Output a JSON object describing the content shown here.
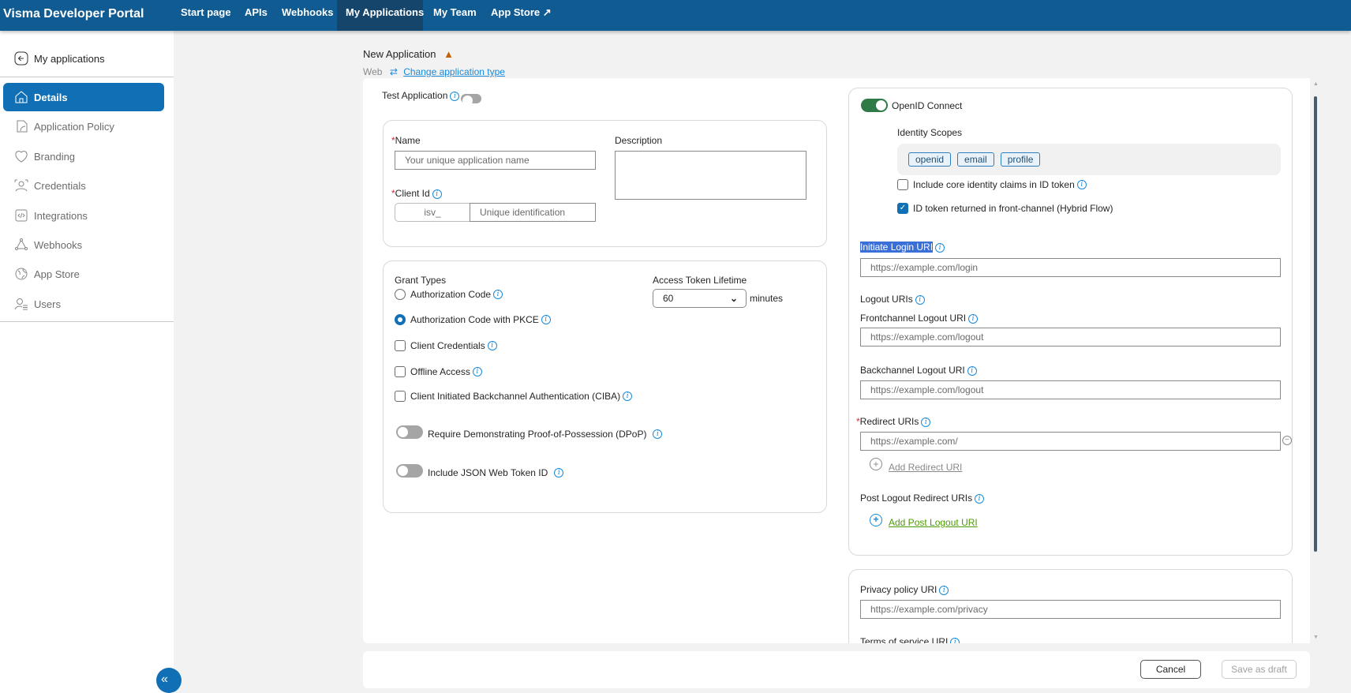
{
  "topnav": {
    "brand": "Visma Developer Portal",
    "items": [
      {
        "label": "Start page"
      },
      {
        "label": "APIs"
      },
      {
        "label": "Webhooks"
      },
      {
        "label": "My Applications",
        "active": true
      },
      {
        "label": "My Team"
      },
      {
        "label": "App Store"
      }
    ]
  },
  "sidebar": {
    "back": "My applications",
    "items": [
      {
        "label": "Details",
        "icon": "home-icon"
      },
      {
        "label": "Application Policy",
        "icon": "policy-icon"
      },
      {
        "label": "Branding",
        "icon": "heart-icon"
      },
      {
        "label": "Credentials",
        "icon": "credentials-icon"
      },
      {
        "label": "Integrations",
        "icon": "code-icon"
      },
      {
        "label": "Webhooks",
        "icon": "webhook-icon"
      },
      {
        "label": "App Store",
        "icon": "globe-icon"
      },
      {
        "label": "Users",
        "icon": "users-icon"
      }
    ]
  },
  "header": {
    "title": "New Application",
    "type": "Web",
    "change_type": "Change application type"
  },
  "form": {
    "test_application": "Test Application",
    "name_label": "Name",
    "name_placeholder": "Your unique application name",
    "description_label": "Description",
    "client_id_label": "Client Id",
    "client_id_prefix": "isv_",
    "client_id_placeholder": "Unique identification",
    "grant_types_label": "Grant Types",
    "grant_types": [
      {
        "label": "Authorization Code",
        "type": "radio",
        "checked": false
      },
      {
        "label": "Authorization Code with PKCE",
        "type": "radio",
        "checked": true
      },
      {
        "label": "Client Credentials",
        "type": "checkbox",
        "checked": false
      },
      {
        "label": "Offline Access",
        "type": "checkbox",
        "checked": false
      },
      {
        "label": "Client Initiated Backchannel Authentication (CIBA)",
        "type": "checkbox",
        "checked": false
      }
    ],
    "dpop": "Require Demonstrating Proof-of-Possession (DPoP)",
    "jwt_id": "Include JSON Web Token ID",
    "access_token_lifetime_label": "Access Token Lifetime",
    "access_token_lifetime_value": "60",
    "minutes": "minutes"
  },
  "oidc": {
    "label": "OpenID Connect",
    "enabled": true,
    "identity_scopes_label": "Identity Scopes",
    "scopes": [
      "openid",
      "email",
      "profile"
    ],
    "include_claims": "Include core identity claims in ID token",
    "include_claims_checked": false,
    "hybrid": "ID token returned in front-channel (Hybrid Flow)",
    "hybrid_checked": true,
    "initiate_login_label": "Initiate Login URI",
    "initiate_login_placeholder": "https://example.com/login",
    "logout_label": "Logout URIs",
    "frontchannel_label": "Frontchannel Logout URI",
    "frontchannel_placeholder": "https://example.com/logout",
    "backchannel_label": "Backchannel Logout URI",
    "backchannel_placeholder": "https://example.com/logout",
    "redirect_label": "Redirect URIs",
    "redirect_placeholder": "https://example.com/",
    "add_redirect": "Add Redirect URI",
    "post_logout_label": "Post Logout Redirect URIs",
    "add_post_logout": "Add Post Logout URI",
    "privacy_label": "Privacy policy URI",
    "privacy_placeholder": "https://example.com/privacy",
    "terms_label": "Terms of service URI"
  },
  "footer": {
    "cancel": "Cancel",
    "save_draft": "Save as draft"
  }
}
